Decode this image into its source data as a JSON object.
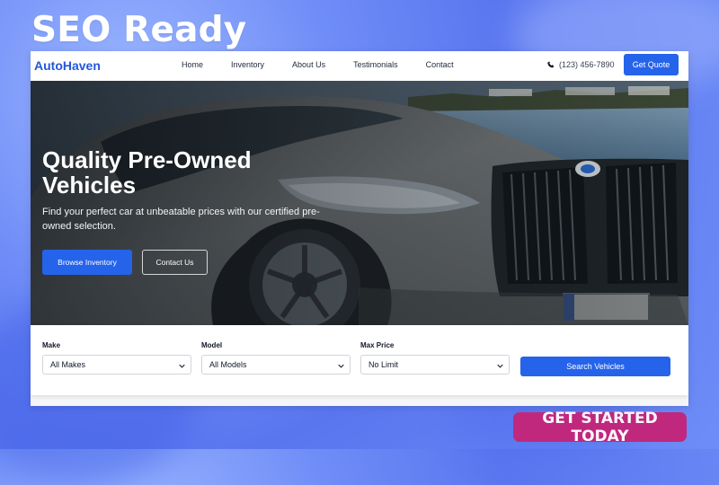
{
  "overlay": {
    "title": "SEO Ready",
    "cta_label": "GET STARTED TODAY"
  },
  "site": {
    "logo": "AutoHaven",
    "nav": [
      {
        "label": "Home"
      },
      {
        "label": "Inventory"
      },
      {
        "label": "About Us"
      },
      {
        "label": "Testimonials"
      },
      {
        "label": "Contact"
      }
    ],
    "phone": "(123) 456-7890",
    "quote_label": "Get Quote"
  },
  "hero": {
    "heading": "Quality Pre-Owned Vehicles",
    "subtitle": "Find your perfect car at unbeatable prices with our certified pre-owned selection.",
    "primary_label": "Browse Inventory",
    "secondary_label": "Contact Us"
  },
  "search": {
    "make_label": "Make",
    "make_value": "All Makes",
    "model_label": "Model",
    "model_value": "All Models",
    "price_label": "Max Price",
    "price_value": "No Limit",
    "button_label": "Search Vehicles"
  },
  "colors": {
    "brand": "#2457db",
    "primary": "#2563eb",
    "cta": "#c0287e",
    "background": "#6f8cf7"
  },
  "icons": {
    "phone": "phone-icon",
    "select_chevron": "chevron-down-icon"
  }
}
